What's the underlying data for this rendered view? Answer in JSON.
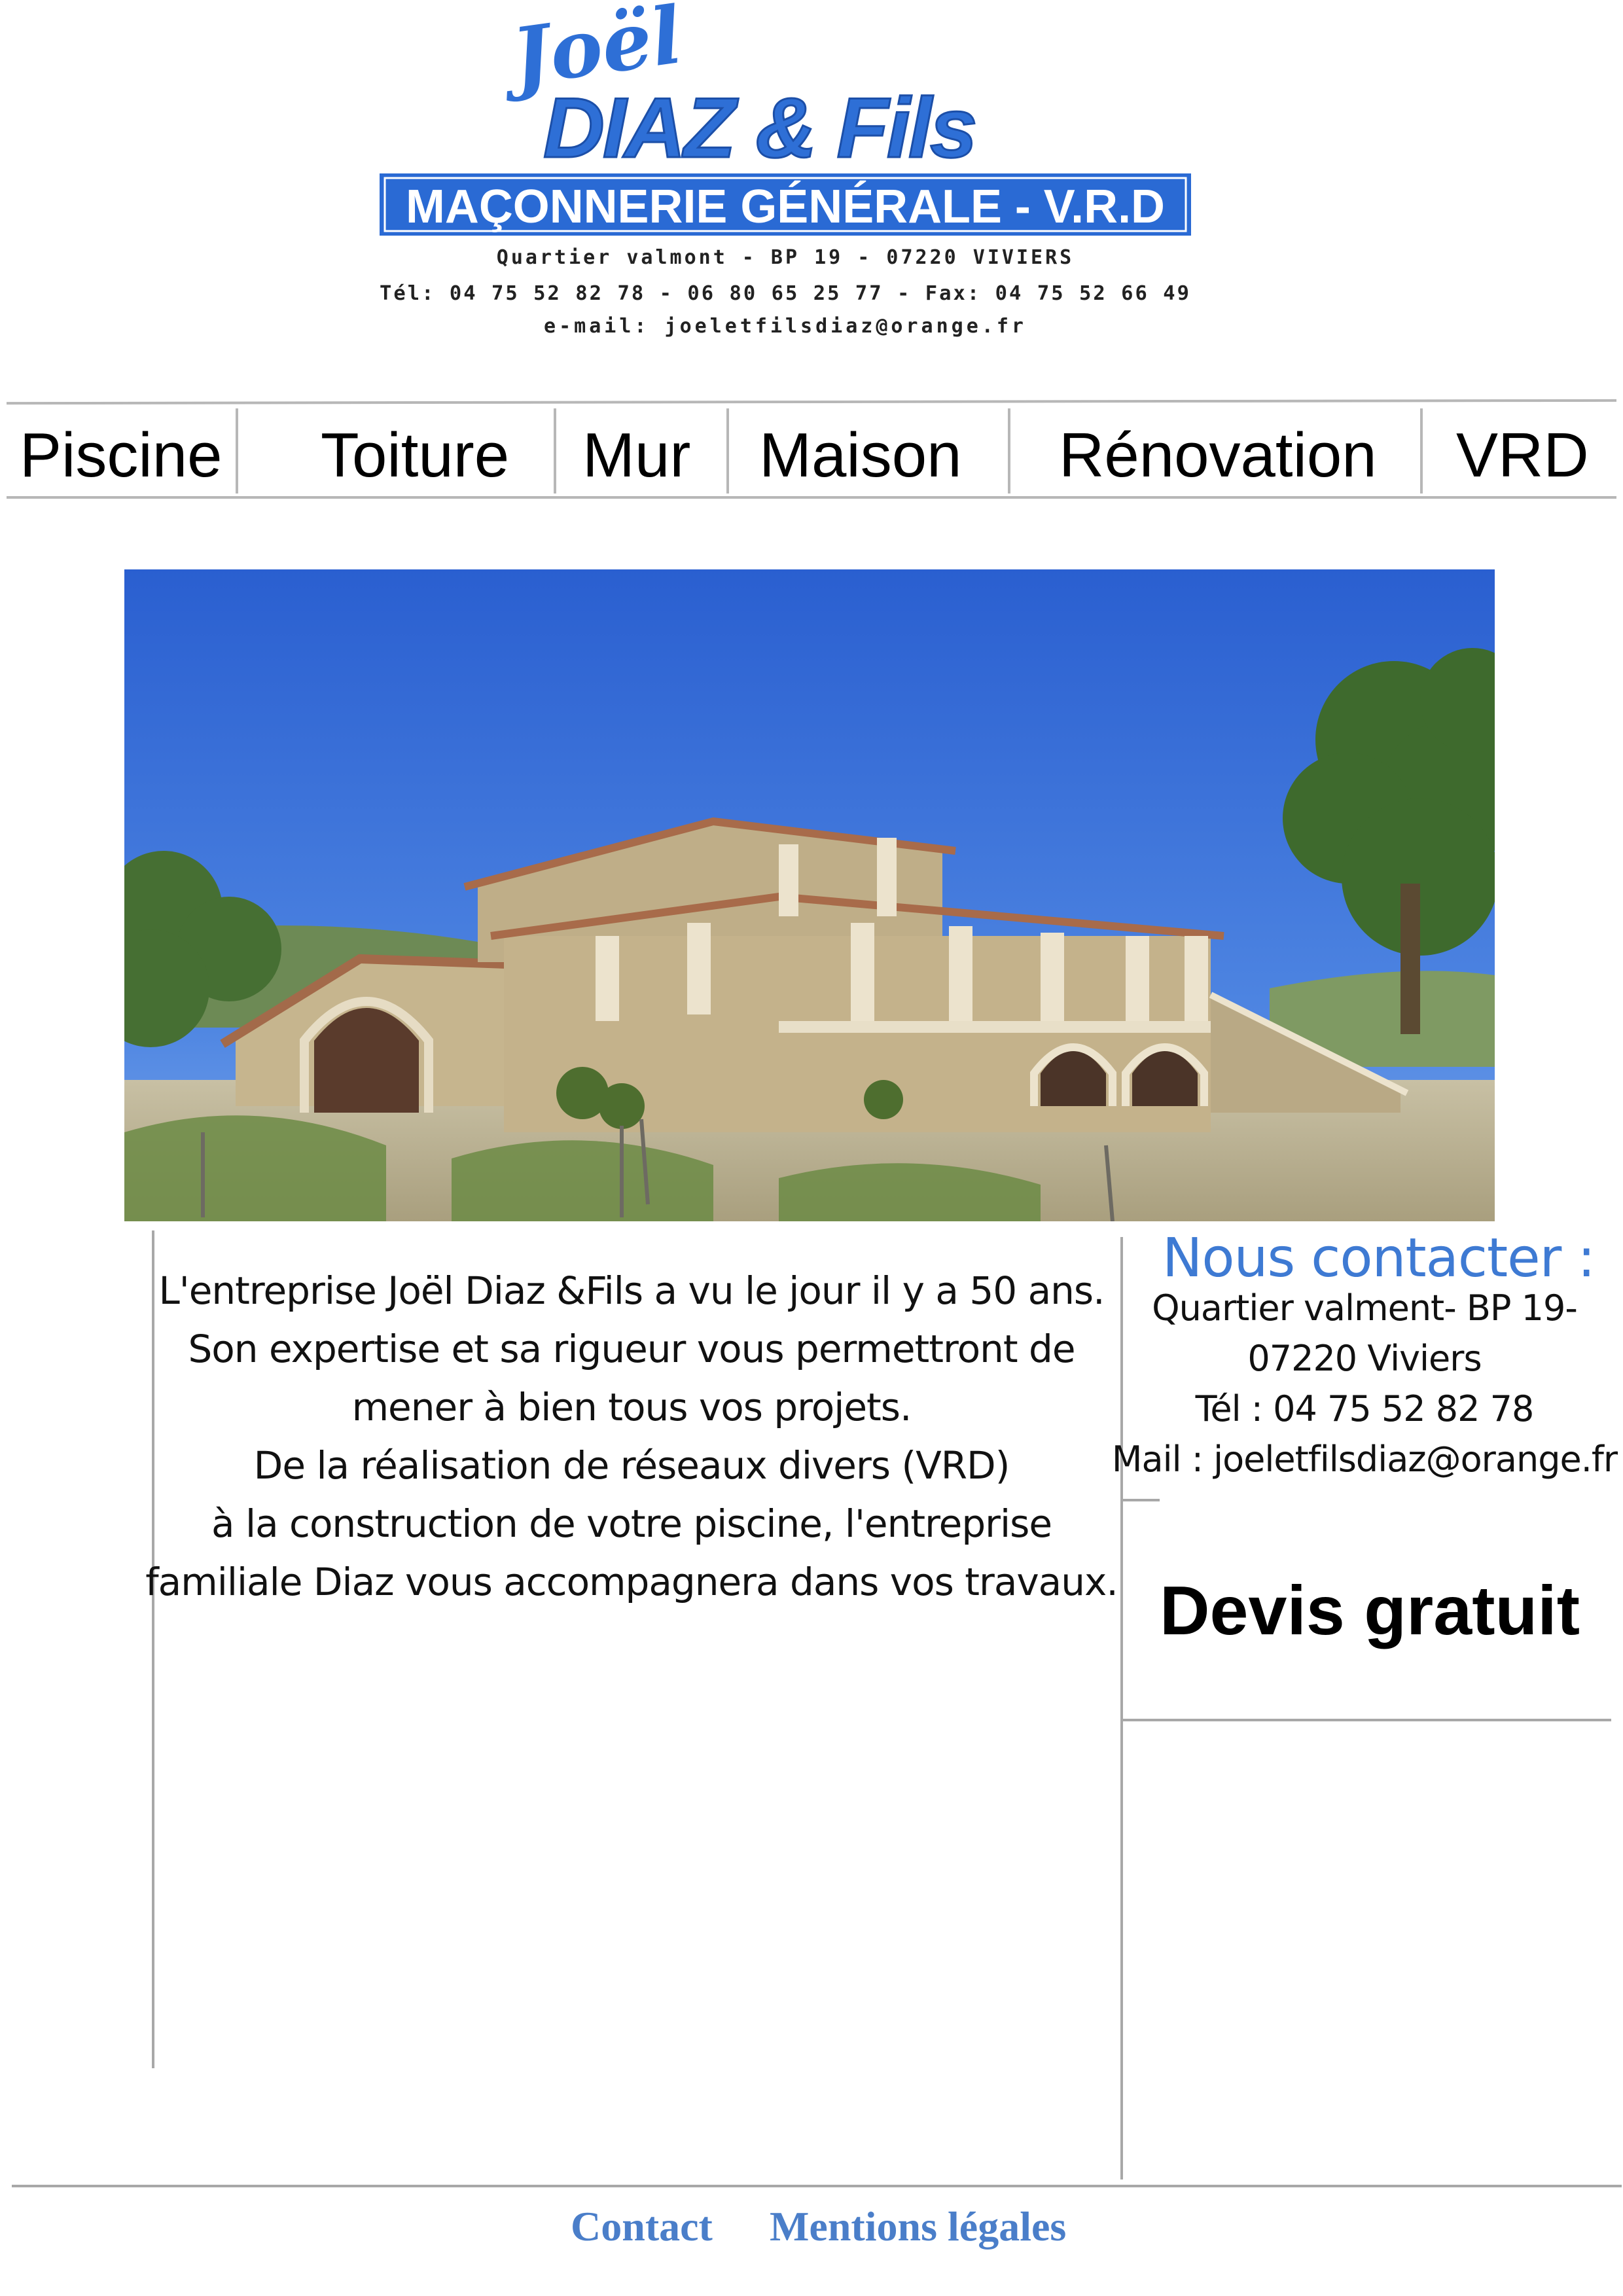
{
  "logo": {
    "script_name": "Joël",
    "brand": "DIAZ & Fils",
    "tagline": "MAÇONNERIE GÉNÉRALE - V.R.D",
    "address": "Quartier valmont - BP 19 - 07220 VIVIERS",
    "phones": "Tél: 04 75 52 82 78 - 06 80 65 25 77 - Fax: 04 75 52 66 49",
    "email": "e-mail: joeletfilsdiaz@orange.fr",
    "brand_color": "#2e6fd6",
    "banner_color": "#2a6ad4"
  },
  "nav": {
    "items": [
      {
        "label": "Piscine"
      },
      {
        "label": "Toiture"
      },
      {
        "label": "Mur"
      },
      {
        "label": "Maison"
      },
      {
        "label": "Rénovation"
      },
      {
        "label": "VRD"
      }
    ]
  },
  "hero": {
    "sky_color": "#2f66d2",
    "stone_color": "#c9b892"
  },
  "intro": {
    "lines": [
      "L'entreprise Joël Diaz &Fils a vu le jour il y a 50 ans.",
      "Son expertise et sa rigueur vous permettront de",
      "mener à bien tous vos projets.",
      "De la réalisation de réseaux divers (VRD)",
      "à la construction de votre piscine, l'entreprise",
      "familiale Diaz vous accompagnera dans vos travaux."
    ]
  },
  "contact": {
    "title": "Nous contacter :",
    "lines": [
      "Quartier valment- BP 19-",
      "07220 Viviers",
      "Tél : 04 75 52 82 78",
      "Mail : joeletfilsdiaz@orange.fr"
    ],
    "title_color": "#3e7ad3"
  },
  "devis": {
    "label": "Devis gratuit"
  },
  "footer": {
    "contact_label": "Contact",
    "legal_label": "Mentions légales",
    "link_color": "#4a7ec9"
  }
}
